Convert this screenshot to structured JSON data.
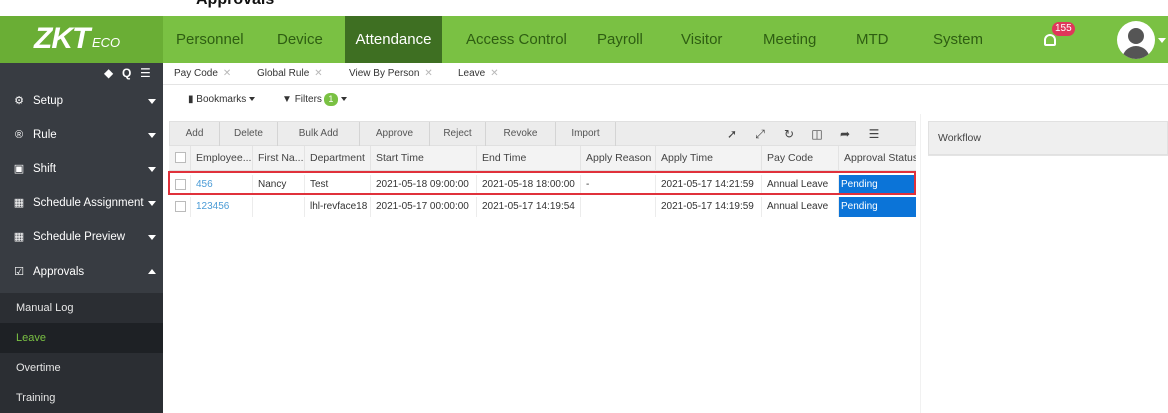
{
  "caption": "Approvals",
  "brand": {
    "logo_main": "ZKT",
    "logo_sub": "ECO",
    "accent": "#7ac143"
  },
  "topnav": {
    "items": [
      {
        "label": "Personnel"
      },
      {
        "label": "Device"
      },
      {
        "label": "Attendance",
        "active": true
      },
      {
        "label": "Access Control"
      },
      {
        "label": "Payroll"
      },
      {
        "label": "Visitor"
      },
      {
        "label": "Meeting"
      },
      {
        "label": "MTD"
      },
      {
        "label": "System"
      }
    ],
    "notification_count": "155"
  },
  "sidebar": {
    "items": [
      {
        "label": "Setup",
        "icon": "gear-icon"
      },
      {
        "label": "Rule",
        "icon": "registered-icon"
      },
      {
        "label": "Shift",
        "icon": "calendar-icon"
      },
      {
        "label": "Schedule Assignment",
        "icon": "calendar-grid-icon"
      },
      {
        "label": "Schedule Preview",
        "icon": "calendar-grid-icon"
      },
      {
        "label": "Approvals",
        "icon": "check-square-icon",
        "expanded": true
      }
    ],
    "subitems": [
      {
        "label": "Manual Log"
      },
      {
        "label": "Leave",
        "active": true
      },
      {
        "label": "Overtime"
      },
      {
        "label": "Training"
      }
    ]
  },
  "tabs": [
    {
      "label": "Pay Code"
    },
    {
      "label": "Global Rule"
    },
    {
      "label": "View By Person"
    },
    {
      "label": "Leave",
      "active": true
    }
  ],
  "filterbar": {
    "bookmarks": "Bookmarks",
    "filters": "Filters",
    "filter_count": "1"
  },
  "toolbar": {
    "buttons": [
      "Add",
      "Delete",
      "Bulk Add",
      "Approve",
      "Reject",
      "Revoke",
      "Import"
    ]
  },
  "table": {
    "columns": [
      "Employee...",
      "First Na...",
      "Department",
      "Start Time",
      "End Time",
      "Apply Reason",
      "Apply Time",
      "Pay Code",
      "Approval Status"
    ],
    "rows": [
      [
        "456",
        "Nancy",
        "Test",
        "2021-05-18 09:00:00",
        "2021-05-18 18:00:00",
        "-",
        "2021-05-17 14:21:59",
        "Annual Leave",
        "Pending"
      ],
      [
        "123456",
        "",
        "lhl-revface18",
        "2021-05-17 00:00:00",
        "2021-05-17 14:19:54",
        "",
        "2021-05-17 14:19:59",
        "Annual Leave",
        "Pending"
      ]
    ]
  },
  "workflow": {
    "title": "Workflow"
  },
  "colors": {
    "status_pending": "#0b74d8",
    "highlight": "#e0313b",
    "sidebar_bg": "#383c42"
  }
}
